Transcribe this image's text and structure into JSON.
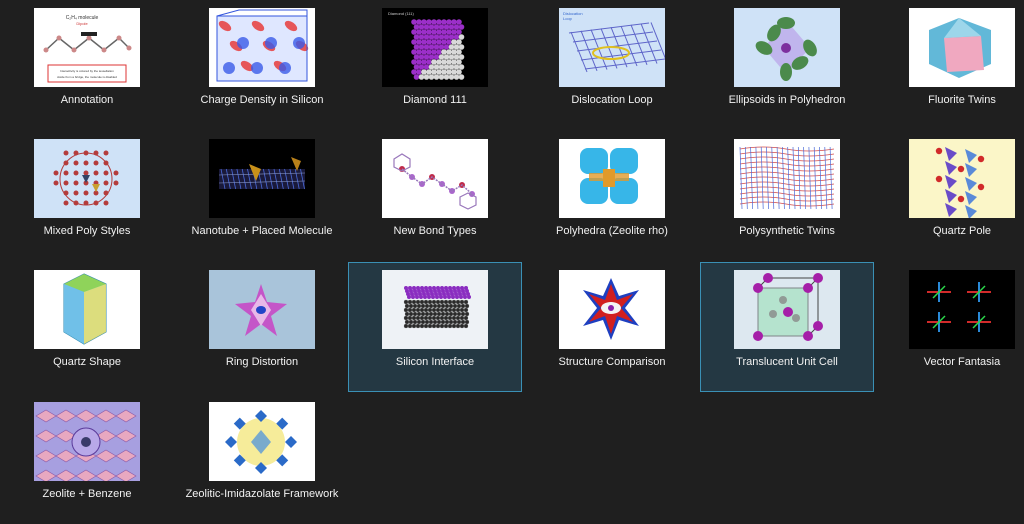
{
  "gallery": {
    "items": [
      {
        "label": "Annotation",
        "selected": false,
        "bg": "#ffffff",
        "icon": "annotation-thumbnail-icon",
        "annotation": {
          "title": "C₂H₄ molecule",
          "subtitle": "Dipole",
          "lines": [
            "Interactivity is colored by the tessellation",
            "Aside from a bridge, the molecule is disabled"
          ]
        }
      },
      {
        "label": "Charge Density in Silicon",
        "selected": false,
        "bg": "#ffffff",
        "icon": "charge-density-thumbnail-icon"
      },
      {
        "label": "Diamond 111",
        "selected": false,
        "bg": "#000000",
        "icon": "diamond-111-thumbnail-icon",
        "corner_text": "Diamond (111)"
      },
      {
        "label": "Dislocation Loop",
        "selected": false,
        "bg": "#cfe2f7",
        "icon": "dislocation-loop-thumbnail-icon",
        "corner_text": "Dislocation",
        "corner_text2": "Loop"
      },
      {
        "label": "Ellipsoids in Polyhedron",
        "selected": false,
        "bg": "#cfe2f7",
        "icon": "ellipsoids-thumbnail-icon"
      },
      {
        "label": "Fluorite Twins",
        "selected": false,
        "bg": "#ffffff",
        "icon": "fluorite-twins-thumbnail-icon"
      },
      {
        "label": "Mixed Poly Styles",
        "selected": false,
        "bg": "#cfe2f7",
        "icon": "mixed-poly-thumbnail-icon"
      },
      {
        "label": "Nanotube + Placed Molecule",
        "selected": false,
        "bg": "#000000",
        "icon": "nanotube-thumbnail-icon"
      },
      {
        "label": "New Bond Types",
        "selected": false,
        "bg": "#ffffff",
        "icon": "new-bond-types-thumbnail-icon"
      },
      {
        "label": "Polyhedra (Zeolite rho)",
        "selected": false,
        "bg": "#ffffff",
        "icon": "polyhedra-zeolite-thumbnail-icon"
      },
      {
        "label": "Polysynthetic Twins",
        "selected": false,
        "bg": "#ffffff",
        "icon": "polysynthetic-twins-thumbnail-icon"
      },
      {
        "label": "Quartz Pole",
        "selected": false,
        "bg": "#fbf6c8",
        "icon": "quartz-pole-thumbnail-icon"
      },
      {
        "label": "Quartz Shape",
        "selected": false,
        "bg": "#ffffff",
        "icon": "quartz-shape-thumbnail-icon"
      },
      {
        "label": "Ring Distortion",
        "selected": false,
        "bg": "#a9c4da",
        "icon": "ring-distortion-thumbnail-icon"
      },
      {
        "label": "Silicon Interface",
        "selected": true,
        "bg": "#eef2f6",
        "icon": "silicon-interface-thumbnail-icon"
      },
      {
        "label": "Structure Comparison",
        "selected": false,
        "bg": "#ffffff",
        "icon": "structure-comparison-thumbnail-icon"
      },
      {
        "label": "Translucent Unit Cell",
        "selected": true,
        "bg": "#dde8f0",
        "icon": "translucent-unit-cell-thumbnail-icon"
      },
      {
        "label": "Vector Fantasia",
        "selected": false,
        "bg": "#000000",
        "icon": "vector-fantasia-thumbnail-icon"
      },
      {
        "label": "Zeolite + Benzene",
        "selected": false,
        "bg": "#a79fe0",
        "icon": "zeolite-benzene-thumbnail-icon"
      },
      {
        "label": "Zeolitic-Imidazolate Framework",
        "selected": false,
        "bg": "#ffffff",
        "icon": "zif-thumbnail-icon"
      }
    ]
  }
}
